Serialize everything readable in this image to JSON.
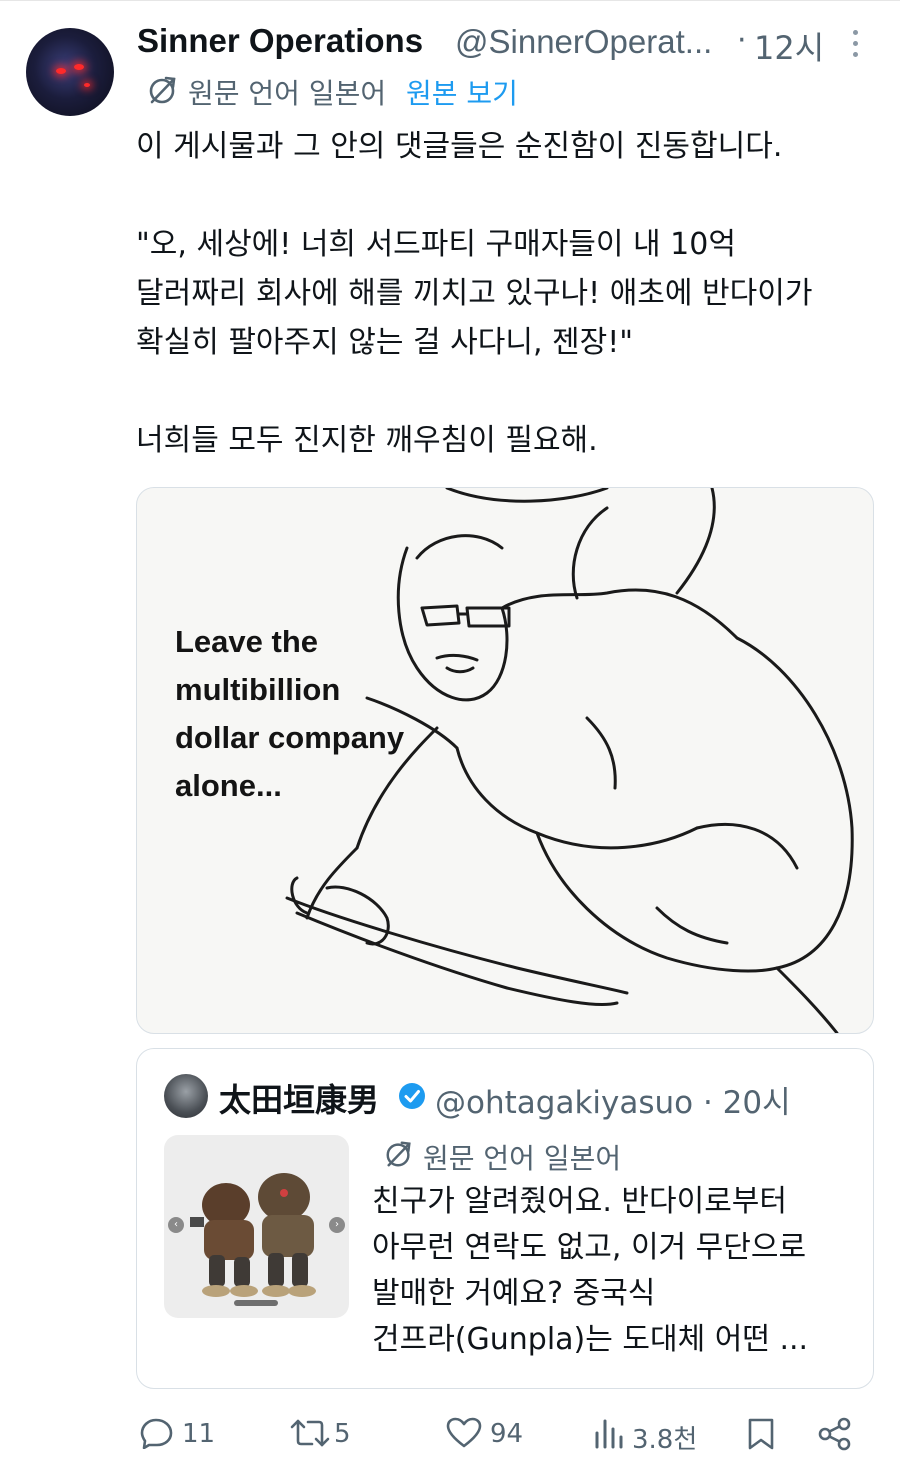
{
  "author": {
    "name": "Sinner Operations",
    "handle": "@SinnerOperat...",
    "time_separator": "·",
    "time": "12시"
  },
  "translation": {
    "label": "원문 언어 일본어",
    "show_original": "원본 보기"
  },
  "tweet": {
    "line1": "이 게시물과 그 안의 댓글들은 순진함이 진동합니다.",
    "line2": "\"오, 세상에! 너희 서드파티 구매자들이 내 10억",
    "line3": "달러짜리 회사에 해를 끼치고 있구나! 애초에 반다이가",
    "line4": "확실히 팔아주지 않는 걸 사다니, 젠장!\"",
    "line5": "너희들 모두 진지한 깨우침이 필요해."
  },
  "media": {
    "meme_text": "Leave the\nmultibillion\ndollar company\nalone..."
  },
  "quote": {
    "name": "太田垣康男",
    "handle_time": "@ohtagakiyasuo · 20시",
    "translation_label": "원문 언어 일본어",
    "line1": "친구가 알려줬어요. 반다이로부터",
    "line2": "아무런 연락도 없고, 이거 무단으로",
    "line3": "발매한 거예요? 중국식",
    "line4": "건프라(Gunpla)는 도대체 어떤 ..."
  },
  "actions": {
    "replies": "11",
    "retweets": "5",
    "likes": "94",
    "views": "3.8천"
  },
  "colors": {
    "text": "#0f1419",
    "secondary": "#536471",
    "link": "#1d9bf0",
    "border": "#d9e0e6"
  },
  "icons": [
    "more-icon",
    "translate-icon",
    "verified-icon",
    "reply-icon",
    "retweet-icon",
    "like-icon",
    "views-icon",
    "bookmark-icon",
    "share-icon"
  ]
}
